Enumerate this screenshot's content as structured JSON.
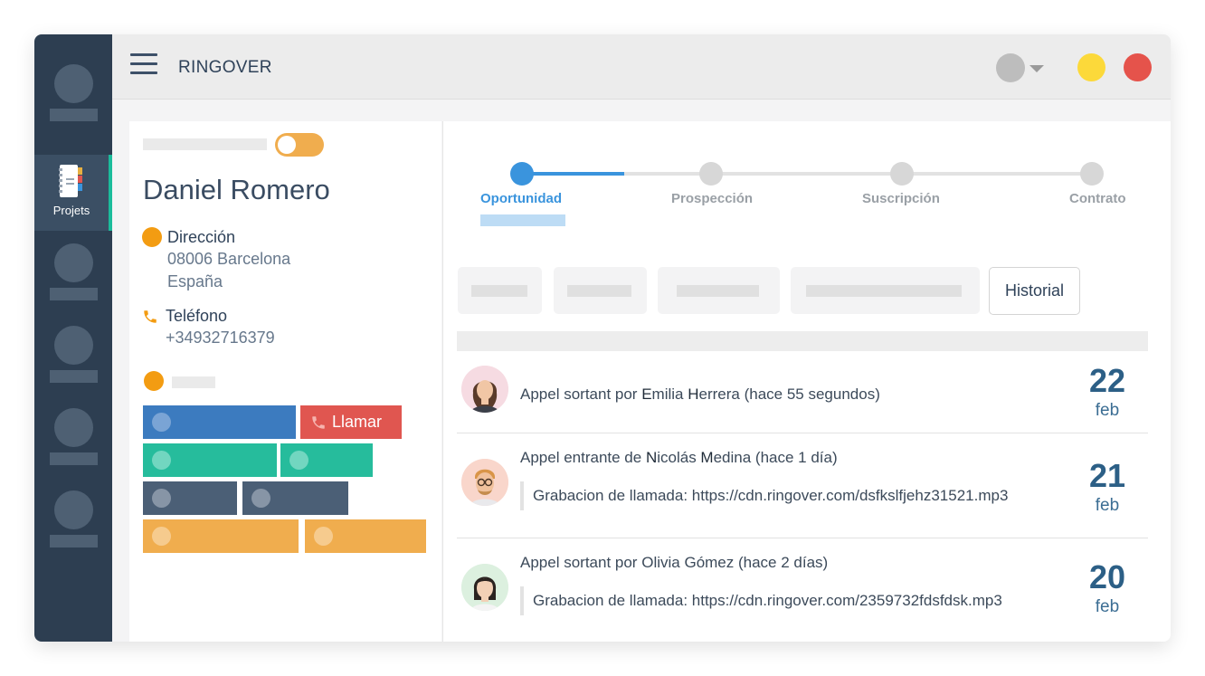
{
  "app": {
    "brand": "RINGOVER"
  },
  "sidebar": {
    "active_label": "Projets"
  },
  "contact": {
    "name": "Daniel Romero",
    "address_label": "Dirección",
    "address_line1": "08006 Barcelona",
    "address_line2": "España",
    "phone_label": "Teléfono",
    "phone": "+34932716379",
    "call_label": "Llamar"
  },
  "pipeline": {
    "steps": [
      "Oportunidad",
      "Prospección",
      "Suscripción",
      "Contrato"
    ],
    "active_step": 0
  },
  "tabs": {
    "history_label": "Historial"
  },
  "history": [
    {
      "prefix": "Appel sortant por ",
      "name_a": "E",
      "name_b": "milia ",
      "name_c": "H",
      "name_d": "errera",
      "suffix": " (hace 55 segundos)",
      "recording": "",
      "day": "22",
      "month": "feb"
    },
    {
      "prefix": "Appel entrante de ",
      "name_a": "N",
      "name_b": "icolás ",
      "name_c": "M",
      "name_d": "edina",
      "suffix": " (hace 1 día)",
      "recording": "Grabacion de llamada: https://cdn.ringover.com/dsfkslfjehz31521.mp3",
      "day": "21",
      "month": "feb"
    },
    {
      "prefix": "Appel sortant por ",
      "name_a": "O",
      "name_b": "livia ",
      "name_c": "G",
      "name_d": "ómez",
      "suffix": " (hace 2 días)",
      "recording": "Grabacion de llamada: https://cdn.ringover.com/2359732fdsfdsk.mp3",
      "day": "20",
      "month": "feb"
    }
  ],
  "colors": {
    "accent_blue": "#3a94dd",
    "rail": "#2d3e51",
    "call_red": "#e05650",
    "orange": "#f39c12",
    "teal": "#26bc9c",
    "slate": "#4b5f76",
    "yellow_window": "#fcd93a",
    "red_window": "#e5534b"
  }
}
